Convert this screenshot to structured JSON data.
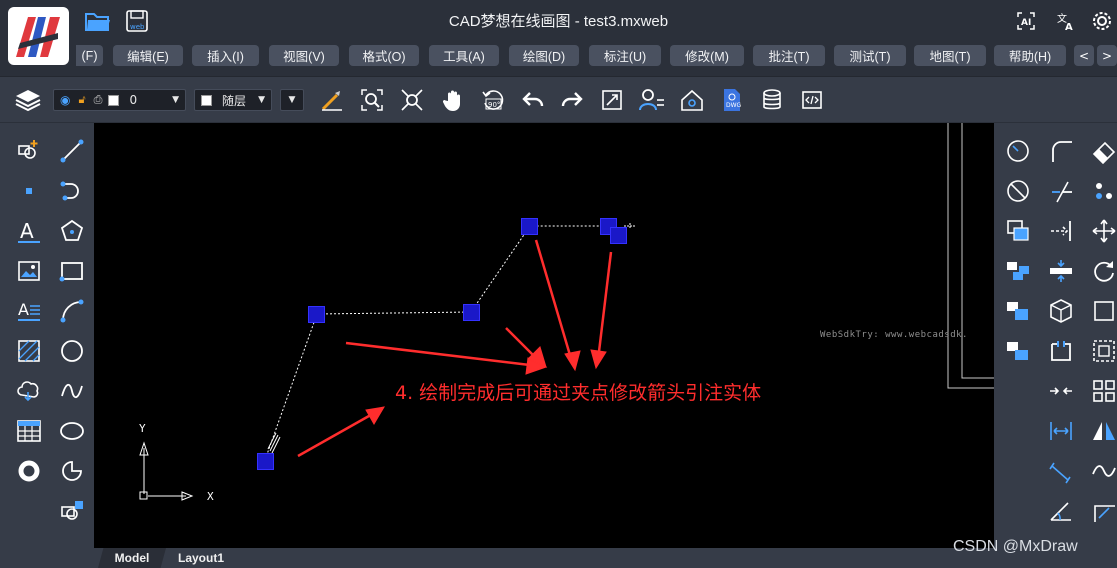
{
  "app": {
    "title": "CAD梦想在线画图 - test3.mxweb"
  },
  "menu": {
    "items": [
      "(F)",
      "编辑(E)",
      "插入(I)",
      "视图(V)",
      "格式(O)",
      "工具(A)",
      "绘图(D)",
      "标注(U)",
      "修改(M)",
      "批注(T)",
      "测试(T)",
      "地图(T)",
      "帮助(H)"
    ],
    "prev": "<",
    "next": ">"
  },
  "toolbar": {
    "layer_number": "0",
    "linetype": "随层",
    "rotate_label": "90°"
  },
  "canvas": {
    "annotation": "4. 绘制完成后可通过夹点修改箭头引注实体",
    "small_text": "WebSdkTry: www.webcadsdk.",
    "axis_y": "Y",
    "axis_x": "X",
    "background": "#000000",
    "grip_color": "#1a18c8",
    "arrow_color": "#ff2d2d"
  },
  "tabs": {
    "model": "Model",
    "layout1": "Layout1"
  },
  "watermark": "CSDN @MxDraw",
  "icons": {
    "left": [
      "insert-block-icon",
      "line-icon",
      "point-icon",
      "polyline-arc-icon",
      "text-icon",
      "polygon-icon",
      "image-icon",
      "rectangle-icon",
      "mtext-icon",
      "arc-icon",
      "hatch-icon",
      "circle-icon",
      "revision-cloud-icon",
      "spline-icon",
      "table-icon",
      "ellipse-icon",
      "donut-icon",
      "ellipse-arc-icon",
      "block-edit-icon"
    ],
    "right": [
      "circle-tool-icon",
      "fillet-icon",
      "erase-icon",
      "no-entry-icon",
      "trim-icon",
      "point-group-icon",
      "copy-icon",
      "extend-icon",
      "move-icon",
      "array-icon",
      "stretch-icon",
      "rotate-icon",
      "layer-icon",
      "box-3d-icon",
      "select-icon",
      "explode-icon",
      "break-icon",
      "frame-icon",
      "join-icon",
      "grid-icon",
      "dimension-icon",
      "mirror-icon",
      "dim-aligned-icon",
      "wave-icon",
      "angle-icon",
      "leader-icon"
    ]
  }
}
